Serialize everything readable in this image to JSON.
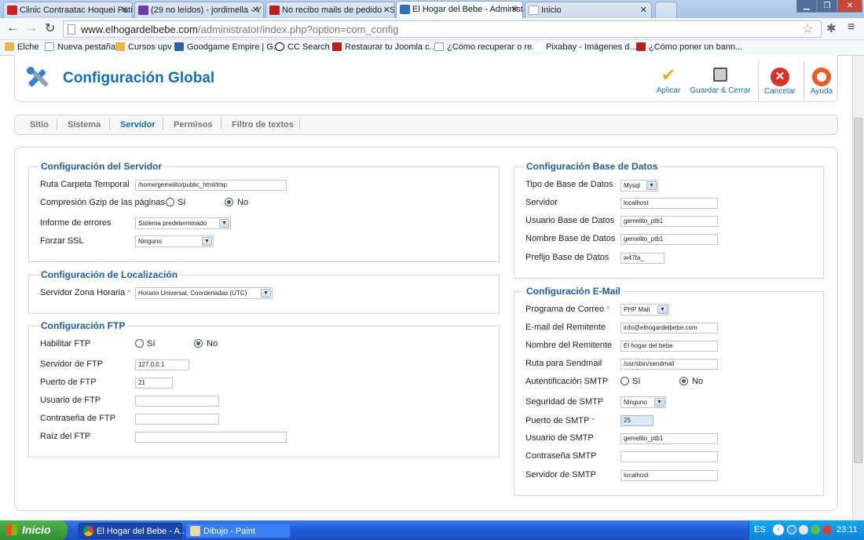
{
  "browser": {
    "tabs": [
      {
        "title": "Clinic Contraatac Hoquei Pati",
        "color": "#cc2222"
      },
      {
        "title": "(29 no leídos) - jordimella - Y",
        "color": "#6b3fa0"
      },
      {
        "title": "No recibo mails de pedido - S",
        "color": "#b3231a"
      },
      {
        "title": "El Hogar del Bebe - Administr",
        "color": "#2d6fb8"
      },
      {
        "title": "Inicio",
        "color": "#ffffff"
      }
    ],
    "url_domain": "www.elhogardelbebe.com",
    "url_path": "/administrator/index.php?option=com_config",
    "bookmarks": [
      {
        "label": "Elche",
        "icon": "folder-icon"
      },
      {
        "label": "Nueva pestaña",
        "icon": "page-icon"
      },
      {
        "label": "Cursos upv",
        "icon": "folder-icon"
      },
      {
        "label": "Goodgame Empire | G...",
        "icon": "grid-icon"
      },
      {
        "label": "CC Search",
        "icon": "cc-icon"
      },
      {
        "label": "Restaurar tu Joomla c...",
        "icon": "w-icon"
      },
      {
        "label": "¿Cómo recuperar o re...",
        "icon": "page-icon"
      },
      {
        "label": "Pixabay - Imágenes d...",
        "icon": "px-icon"
      },
      {
        "label": "¿Cómo poner un bann...",
        "icon": "w-icon"
      }
    ]
  },
  "header": {
    "title": "Configuración Global",
    "buttons": {
      "apply": "Aplicar",
      "save_close": "Guardar & Cerrar",
      "cancel": "Cancelar",
      "help": "Ayuda"
    }
  },
  "subnav": [
    "Sitio",
    "Sistema",
    "Servidor",
    "Permisos",
    "Filtro de textos"
  ],
  "server": {
    "legend": "Configuración del Servidor",
    "temp_label": "Ruta Carpeta Temporal",
    "temp_value": "/home/gemelito/public_html/tmp",
    "gzip_label": "Compresión Gzip de las páginas",
    "yes": "Sí",
    "no": "No",
    "errors_label": "Informe de errores",
    "errors_value": "Sistema predeterminado",
    "ssl_label": "Forzar SSL",
    "ssl_value": "Ninguno"
  },
  "locale": {
    "legend": "Configuración de Localización",
    "tz_label": "Servidor Zona Horaria",
    "tz_value": "Horario Universal, Coordenadas (UTC)"
  },
  "ftp": {
    "legend": "Configuración FTP",
    "enable_label": "Habilitar FTP",
    "host_label": "Servidor de FTP",
    "host_value": "127.0.0.1",
    "port_label": "Puerto de FTP",
    "port_value": "21",
    "user_label": "Usuario de FTP",
    "pass_label": "Contraseña de FTP",
    "root_label": "Raíz del FTP"
  },
  "database": {
    "legend": "Configuración Base de Datos",
    "type_label": "Tipo de Base de Datos",
    "type_value": "Mysql",
    "host_label": "Servidor",
    "host_value": "localhost",
    "user_label": "Usuario Base de Datos",
    "user_value": "gemelito_ptb1",
    "name_label": "Nombre Base de Datos",
    "name_value": "gemelito_ptb1",
    "prefix_label": "Prefijo Base de Datos",
    "prefix_value": "w47fa_"
  },
  "mail": {
    "legend": "Configuración E-Mail",
    "mailer_label": "Programa de Correo",
    "mailer_value": "PHP Mail",
    "from_label": "E-mail del Remitente",
    "from_value": "info@elhogardelbebe.com",
    "fromname_label": "Nombre del Remitente",
    "fromname_value": "El hogar del bebe",
    "sendmail_label": "Ruta para Sendmail",
    "sendmail_value": "/usr/sbin/sendmail",
    "smtpauth_label": "Autentificación SMTP",
    "smtpsecure_label": "Seguridad de SMTP",
    "smtpsecure_value": "Ninguno",
    "smtpport_label": "Puerto de SMTP",
    "smtpport_value": "25",
    "smtpuser_label": "Usuario de SMTP",
    "smtpuser_value": "gemelito_ptb1",
    "smtppass_label": "Contraseña SMTP",
    "smtphost_label": "Servidor de SMTP",
    "smtphost_value": "localhost"
  },
  "taskbar": {
    "start": "Inicio",
    "tasks": [
      "El Hogar del Bebe - A...",
      "Dibujo - Paint"
    ],
    "lang": "ES",
    "clock": "23:11"
  },
  "colors": {
    "accent": "#176eb1",
    "legend": "#1c5d9a",
    "required": "#e8781c"
  }
}
